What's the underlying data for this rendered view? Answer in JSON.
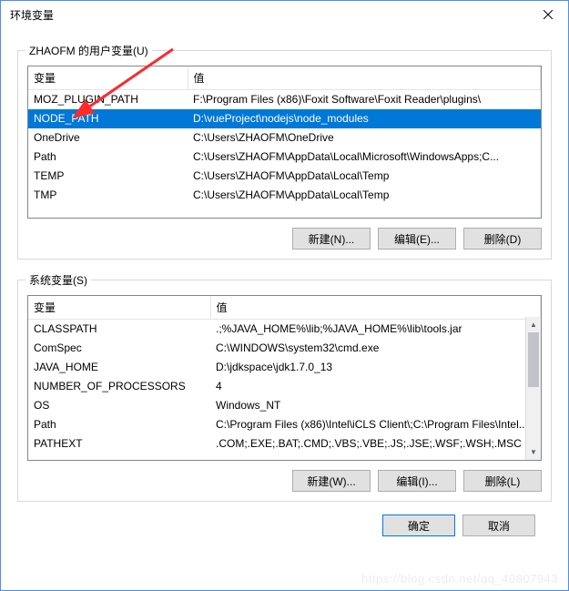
{
  "window": {
    "title": "环境变量"
  },
  "userGroup": {
    "label": "ZHAOFM 的用户变量(U)",
    "columns": {
      "name": "变量",
      "value": "值"
    },
    "rows": [
      {
        "name": "MOZ_PLUGIN_PATH",
        "value": "F:\\Program Files (x86)\\Foxit Software\\Foxit Reader\\plugins\\",
        "selected": false
      },
      {
        "name": "NODE_PATH",
        "value": "D:\\vueProject\\nodejs\\node_modules",
        "selected": true
      },
      {
        "name": "OneDrive",
        "value": "C:\\Users\\ZHAOFM\\OneDrive",
        "selected": false
      },
      {
        "name": "Path",
        "value": "C:\\Users\\ZHAOFM\\AppData\\Local\\Microsoft\\WindowsApps;C...",
        "selected": false
      },
      {
        "name": "TEMP",
        "value": "C:\\Users\\ZHAOFM\\AppData\\Local\\Temp",
        "selected": false
      },
      {
        "name": "TMP",
        "value": "C:\\Users\\ZHAOFM\\AppData\\Local\\Temp",
        "selected": false
      }
    ],
    "buttons": {
      "new": "新建(N)...",
      "edit": "编辑(E)...",
      "delete": "删除(D)"
    }
  },
  "sysGroup": {
    "label": "系统变量(S)",
    "columns": {
      "name": "变量",
      "value": "值"
    },
    "rows": [
      {
        "name": "CLASSPATH",
        "value": ".;%JAVA_HOME%\\lib;%JAVA_HOME%\\lib\\tools.jar"
      },
      {
        "name": "ComSpec",
        "value": "C:\\WINDOWS\\system32\\cmd.exe"
      },
      {
        "name": "JAVA_HOME",
        "value": "D:\\jdkspace\\jdk1.7.0_13"
      },
      {
        "name": "NUMBER_OF_PROCESSORS",
        "value": "4"
      },
      {
        "name": "OS",
        "value": "Windows_NT"
      },
      {
        "name": "Path",
        "value": "C:\\Program Files (x86)\\Intel\\iCLS Client\\;C:\\Program Files\\Intel..."
      },
      {
        "name": "PATHEXT",
        "value": ".COM;.EXE;.BAT;.CMD;.VBS;.VBE;.JS;.JSE;.WSF;.WSH;.MSC"
      }
    ],
    "buttons": {
      "new": "新建(W)...",
      "edit": "编辑(I)...",
      "delete": "删除(L)"
    }
  },
  "footer": {
    "ok": "确定",
    "cancel": "取消"
  },
  "watermark": "https://blog.csdn.net/qq_40807943"
}
